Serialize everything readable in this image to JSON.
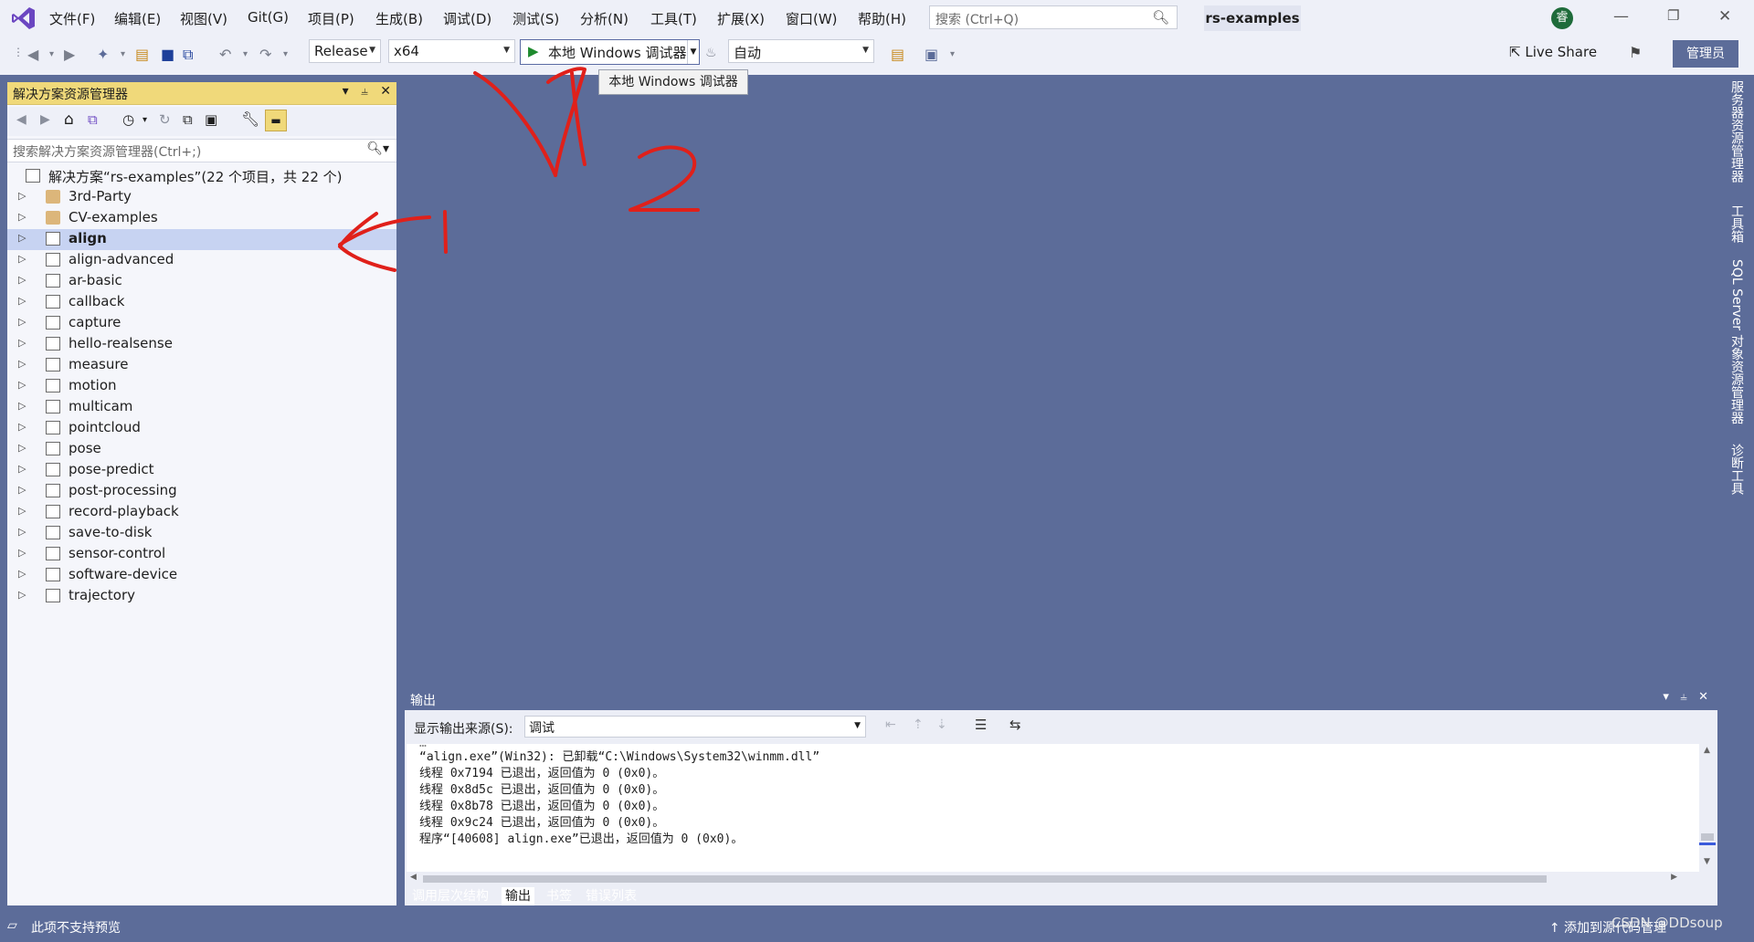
{
  "menu": [
    "文件(F)",
    "编辑(E)",
    "视图(V)",
    "Git(G)",
    "项目(P)",
    "生成(B)",
    "调试(D)",
    "测试(S)",
    "分析(N)",
    "工具(T)",
    "扩展(X)",
    "窗口(W)",
    "帮助(H)"
  ],
  "search": {
    "placeholder": "搜索 (Ctrl+Q)"
  },
  "solution_name": "rs-examples",
  "avatar_letter": "睿",
  "toolbar": {
    "config": "Release",
    "platform": "x64",
    "debug_target": "本地 Windows 调试器",
    "auto": "自动",
    "live_share": "Live Share",
    "admin": "管理员"
  },
  "tooltip": "本地 Windows 调试器",
  "solution_explorer": {
    "title": "解决方案资源管理器",
    "search_placeholder": "搜索解决方案资源管理器(Ctrl+;)",
    "root": "解决方案“rs-examples”(22 个项目，共 22 个)",
    "items": [
      {
        "label": "3rd-Party",
        "type": "folder"
      },
      {
        "label": "CV-examples",
        "type": "folder"
      },
      {
        "label": "align",
        "type": "project"
      },
      {
        "label": "align-advanced",
        "type": "project"
      },
      {
        "label": "ar-basic",
        "type": "project"
      },
      {
        "label": "callback",
        "type": "project"
      },
      {
        "label": "capture",
        "type": "project"
      },
      {
        "label": "hello-realsense",
        "type": "project"
      },
      {
        "label": "measure",
        "type": "project"
      },
      {
        "label": "motion",
        "type": "project"
      },
      {
        "label": "multicam",
        "type": "project"
      },
      {
        "label": "pointcloud",
        "type": "project"
      },
      {
        "label": "pose",
        "type": "project"
      },
      {
        "label": "pose-predict",
        "type": "project"
      },
      {
        "label": "post-processing",
        "type": "project"
      },
      {
        "label": "record-playback",
        "type": "project"
      },
      {
        "label": "save-to-disk",
        "type": "project"
      },
      {
        "label": "sensor-control",
        "type": "project"
      },
      {
        "label": "software-device",
        "type": "project"
      },
      {
        "label": "trajectory",
        "type": "project"
      }
    ],
    "selected": "align"
  },
  "side_tabs": [
    "服务器资源管理器",
    "工具箱",
    "SQL Server 对象资源管理器",
    "诊断工具"
  ],
  "output": {
    "title": "输出",
    "source_label": "显示输出来源(S):",
    "source_value": "调试",
    "lines": [
      "“align.exe”(Win32): 已卸载“C:\\Windows\\System32\\winmm.dll”",
      "线程 0x7194 已退出，返回值为 0 (0x0)。",
      "线程 0x8d5c 已退出，返回值为 0 (0x0)。",
      "线程 0x8b78 已退出，返回值为 0 (0x0)。",
      "线程 0x9c24 已退出，返回值为 0 (0x0)。",
      "程序“[40608] align.exe”已退出，返回值为 0 (0x0)。"
    ]
  },
  "bottom_tabs": [
    "调用层次结构",
    "输出",
    "书签",
    "错误列表"
  ],
  "active_bottom_tab": "输出",
  "status": {
    "left": "此项不支持预览",
    "right": "添加到源代码管理"
  },
  "watermark": "CSDN @DDsoup",
  "annotations": {
    "one": "1",
    "two": "2"
  },
  "colors": {
    "accent": "#5c6c99",
    "selection": "#c7d3f2",
    "annotation": "#e0201a",
    "solution_header": "#f0d97a"
  }
}
